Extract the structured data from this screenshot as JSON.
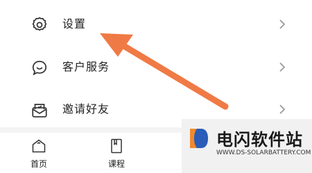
{
  "menu": {
    "items": [
      {
        "label": "设置",
        "icon": "gear-icon"
      },
      {
        "label": "客户服务",
        "icon": "chat-bubble-icon"
      },
      {
        "label": "邀请好友",
        "icon": "invite-envelope-icon"
      }
    ]
  },
  "tabbar": {
    "tabs": [
      {
        "label": "首页",
        "icon": "home-icon"
      },
      {
        "label": "课程",
        "icon": "book-icon"
      }
    ]
  },
  "annotation": {
    "arrow_color": "#f07a45"
  },
  "watermark": {
    "title": "电闪软件站",
    "url": "WWW.DS-SOLARBATTERY.COM"
  }
}
